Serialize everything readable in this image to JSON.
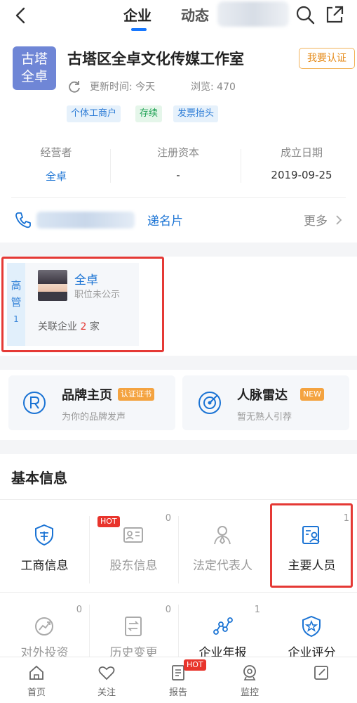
{
  "header": {
    "tabs": [
      "企业",
      "动态"
    ],
    "active_tab": "企业"
  },
  "company": {
    "logo_line1": "古塔",
    "logo_line2": "全卓",
    "name": "古塔区全卓文化传媒工作室",
    "verify_label": "我要认证",
    "update_text": "更新时间: 今天",
    "views_text": "浏览: 470",
    "tags": [
      "个体工商户",
      "存续",
      "发票抬头"
    ]
  },
  "info_cols": [
    {
      "label": "经营者",
      "value": "全卓"
    },
    {
      "label": "注册资本",
      "value": "-"
    },
    {
      "label": "成立日期",
      "value": "2019-09-25"
    }
  ],
  "contact": {
    "card_label": "递名片",
    "more_label": "更多"
  },
  "executives": {
    "tab_label_1": "高",
    "tab_label_2": "管",
    "tab_count": "1",
    "name": "全卓",
    "position": "职位未公示",
    "related_prefix": "关联企业",
    "related_count": "2",
    "related_suffix": "家"
  },
  "promos": [
    {
      "title": "品牌主页",
      "badge": "认证证书",
      "subtitle": "为你的品牌发声",
      "badge_color": "#f4a340",
      "icon": "brand-r-icon"
    },
    {
      "title": "人脉雷达",
      "badge": "NEW",
      "subtitle": "暂无熟人引荐",
      "badge_color": "#f4a340",
      "icon": "radar-icon"
    }
  ],
  "basic_info": {
    "title": "基本信息",
    "row1": [
      {
        "label": "工商信息",
        "count": "",
        "hot": false,
        "icon": "shield-icon"
      },
      {
        "label": "股东信息",
        "count": "0",
        "hot": true,
        "hot_label": "HOT",
        "icon": "id-card-icon"
      },
      {
        "label": "法定代表人",
        "count": "",
        "hot": false,
        "icon": "person-icon"
      },
      {
        "label": "主要人员",
        "count": "1",
        "hot": false,
        "icon": "staff-icon"
      }
    ],
    "row2": [
      {
        "label": "对外投资",
        "count": "0",
        "icon": "investment-icon"
      },
      {
        "label": "历史变更",
        "count": "0",
        "icon": "change-icon"
      },
      {
        "label": "企业年报",
        "count": "1",
        "icon": "report-icon"
      },
      {
        "label": "企业评分",
        "count": "",
        "icon": "rating-icon"
      }
    ]
  },
  "bottom_nav": [
    {
      "label": "首页",
      "icon": "home-icon"
    },
    {
      "label": "关注",
      "icon": "heart-icon"
    },
    {
      "label": "报告",
      "icon": "report-doc-icon",
      "hot_label": "HOT"
    },
    {
      "label": "监控",
      "icon": "camera-icon"
    },
    {
      "label": "",
      "icon": "edit-icon"
    }
  ],
  "colors": {
    "accent": "#1677ff",
    "highlight_box": "#e53935",
    "hot_badge": "#e8342c"
  }
}
